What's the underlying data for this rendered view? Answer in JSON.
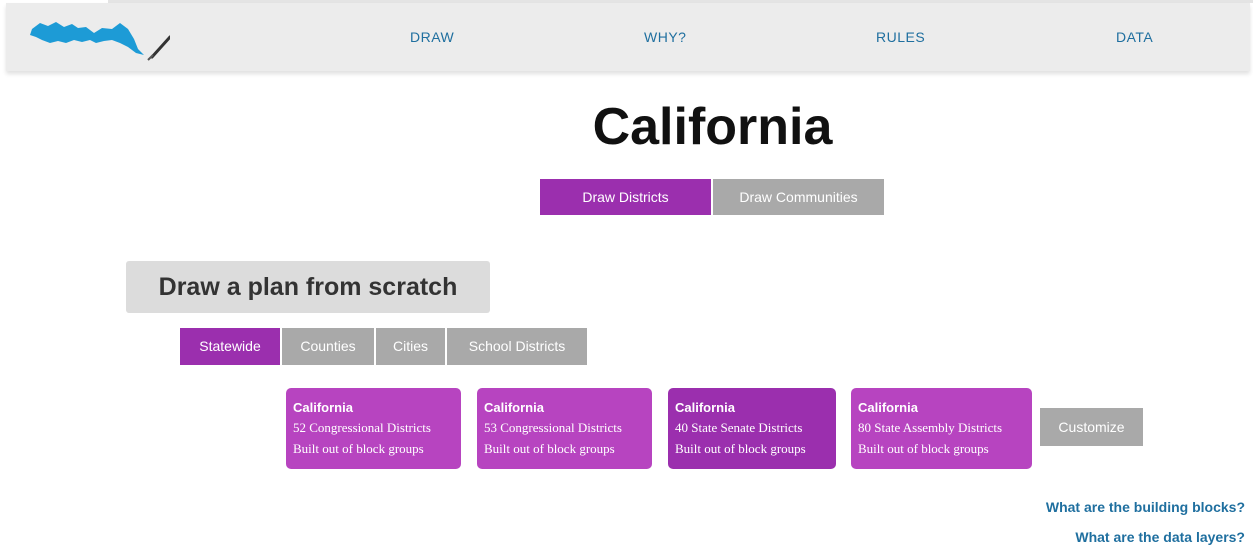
{
  "nav": {
    "items": [
      "DRAW",
      "WHY?",
      "RULES",
      "DATA"
    ]
  },
  "title": "California",
  "modes": [
    "Draw Districts",
    "Draw Communities"
  ],
  "scratch_heading": "Draw a plan from scratch",
  "scopes": [
    "Statewide",
    "Counties",
    "Cities",
    "School Districts"
  ],
  "cards": [
    {
      "state": "California",
      "line1": "52 Congressional Districts",
      "line2": "Built out of block groups"
    },
    {
      "state": "California",
      "line1": "53 Congressional Districts",
      "line2": "Built out of block groups"
    },
    {
      "state": "California",
      "line1": "40 State Senate Districts",
      "line2": "Built out of block groups"
    },
    {
      "state": "California",
      "line1": "80 State Assembly Districts",
      "line2": "Built out of block groups"
    }
  ],
  "customize_label": "Customize",
  "help": {
    "building_blocks": "What are the building blocks?",
    "data_layers": "What are the data layers?"
  },
  "colors": {
    "accent": "#9b2fae",
    "card": "#b744c0",
    "inactive": "#a9a9a9",
    "link": "#1f6f9f",
    "logo": "#1d9bd6"
  }
}
